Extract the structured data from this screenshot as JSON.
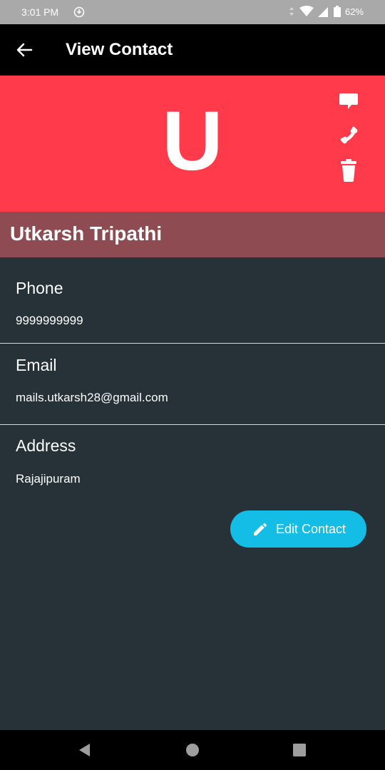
{
  "status_bar": {
    "time": "3:01 PM",
    "battery": "62%"
  },
  "app_bar": {
    "title": "View Contact"
  },
  "hero": {
    "initial": "U",
    "color": "#ff3b4b"
  },
  "contact": {
    "name": "Utkarsh Tripathi",
    "fields": [
      {
        "label": "Phone",
        "value": "9999999999"
      },
      {
        "label": "Email",
        "value": "mails.utkarsh28@gmail.com"
      },
      {
        "label": "Address",
        "value": "Rajajipuram"
      }
    ]
  },
  "actions": {
    "message_icon": "message-icon",
    "call_icon": "phone-icon",
    "delete_icon": "trash-icon",
    "edit_label": "Edit Contact",
    "edit_color": "#13bde6"
  },
  "nav": {
    "back": "back-triangle-icon",
    "home": "home-circle-icon",
    "recents": "recents-square-icon"
  }
}
